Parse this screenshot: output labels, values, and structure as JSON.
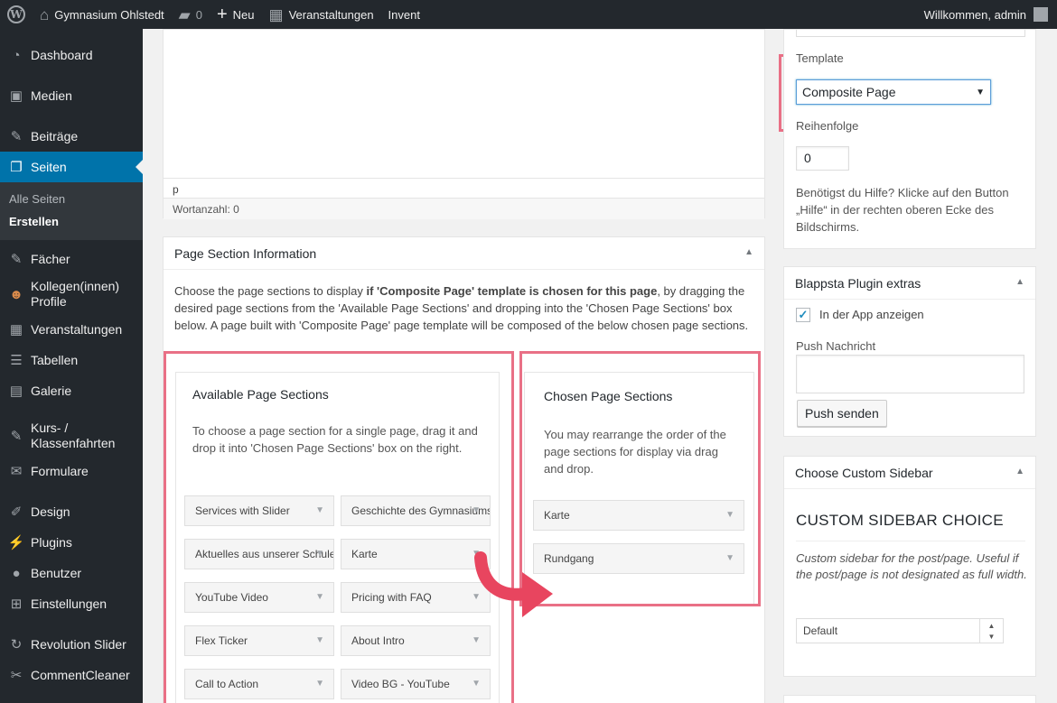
{
  "admin_bar": {
    "site_name": "Gymnasium Ohlstedt",
    "comments_count": "0",
    "new_label": "Neu",
    "events_label": "Veranstaltungen",
    "invent_label": "Invent",
    "greeting": "Willkommen, admin"
  },
  "menu": {
    "dashboard": "Dashboard",
    "media": "Medien",
    "posts": "Beiträge",
    "pages": "Seiten",
    "pages_sub_all": "Alle Seiten",
    "pages_sub_new": "Erstellen",
    "subjects": "Fächer",
    "colleagues_line1": "Kollegen(innen)",
    "colleagues_line2": "Profile",
    "events": "Veranstaltungen",
    "tables": "Tabellen",
    "gallery": "Galerie",
    "courses_line1": "Kurs- /",
    "courses_line2": "Klassenfahrten",
    "forms": "Formulare",
    "design": "Design",
    "plugins": "Plugins",
    "users": "Benutzer",
    "settings": "Einstellungen",
    "revolution_slider": "Revolution Slider",
    "comment_cleaner": "CommentCleaner"
  },
  "editor": {
    "path": "p",
    "word_count": "Wortanzahl: 0"
  },
  "page_sections": {
    "title": "Page Section Information",
    "intro_part1": "Choose the page sections to display ",
    "intro_bold": "if 'Composite Page' template is chosen for this page",
    "intro_part2": ", by dragging the desired page sections from the 'Available Page Sections' and dropping into the 'Chosen Page Sections' box below. A page built with 'Composite Page' page template will be composed of the below chosen page sections.",
    "available": {
      "title": "Available Page Sections",
      "desc": "To choose a page section for a single page, drag it and drop it into 'Chosen Page Sections' box on the right.",
      "items": [
        "Services with Slider",
        "Geschichte des Gymnasiums",
        "Aktuelles aus unserer Schule",
        "Karte",
        "YouTube Video",
        "Pricing with FAQ",
        "Flex Ticker",
        "About Intro",
        "Call to Action",
        "Video BG - YouTube"
      ]
    },
    "chosen": {
      "title": "Chosen Page Sections",
      "desc": "You may rearrange the order of the page sections for display via drag and drop.",
      "items": [
        "Karte",
        "Rundgang"
      ]
    }
  },
  "attributes": {
    "template_label": "Template",
    "template_value": "Composite Page",
    "order_label": "Reihenfolge",
    "order_value": "0",
    "help_text": "Benötigst du Hilfe? Klicke auf den Button „Hilfe“ in der rechten oberen Ecke des Bildschirms."
  },
  "blappsta": {
    "title": "Blappsta Plugin extras",
    "show_in_app": "In der App anzeigen",
    "show_in_app_checked": true,
    "push_label": "Push Nachricht",
    "push_button": "Push senden"
  },
  "custom_sidebar": {
    "title": "Choose Custom Sidebar",
    "heading": "CUSTOM SIDEBAR CHOICE",
    "note": "Custom sidebar for the post/page. Useful if the post/page is not designated as full width.",
    "selected": "Default"
  },
  "colors": {
    "highlight": "#e97086",
    "menu_bg": "#23282d",
    "menu_current": "#0073aa"
  }
}
